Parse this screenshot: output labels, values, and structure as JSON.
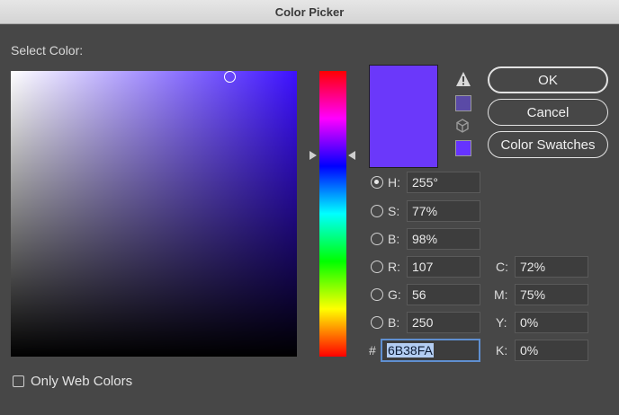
{
  "window": {
    "title": "Color Picker"
  },
  "select_label": "Select Color:",
  "colors": {
    "current": "#6B38FA",
    "field_hue": "#3c10ff",
    "web_safe": "#6633ff",
    "gamut": "#5a4aa6"
  },
  "buttons": {
    "ok": "OK",
    "cancel": "Cancel",
    "swatches": "Color Swatches"
  },
  "hsb": {
    "h": {
      "label": "H:",
      "value": "255°",
      "selected": true
    },
    "s": {
      "label": "S:",
      "value": "77%"
    },
    "b": {
      "label": "B:",
      "value": "98%"
    }
  },
  "rgb": {
    "r": {
      "label": "R:",
      "value": "107"
    },
    "g": {
      "label": "G:",
      "value": "56"
    },
    "b": {
      "label": "B:",
      "value": "250"
    }
  },
  "cmyk": {
    "c": {
      "label": "C:",
      "value": "72%"
    },
    "m": {
      "label": "M:",
      "value": "75%"
    },
    "y": {
      "label": "Y:",
      "value": "0%"
    },
    "k": {
      "label": "K:",
      "value": "0%"
    }
  },
  "hex": {
    "label": "#",
    "value": "6B38FA"
  },
  "options": {
    "only_web_colors": {
      "label": "Only Web Colors",
      "checked": false
    }
  },
  "icons": {
    "warning": "warning-triangle-icon",
    "web_safe": "cube-icon"
  }
}
